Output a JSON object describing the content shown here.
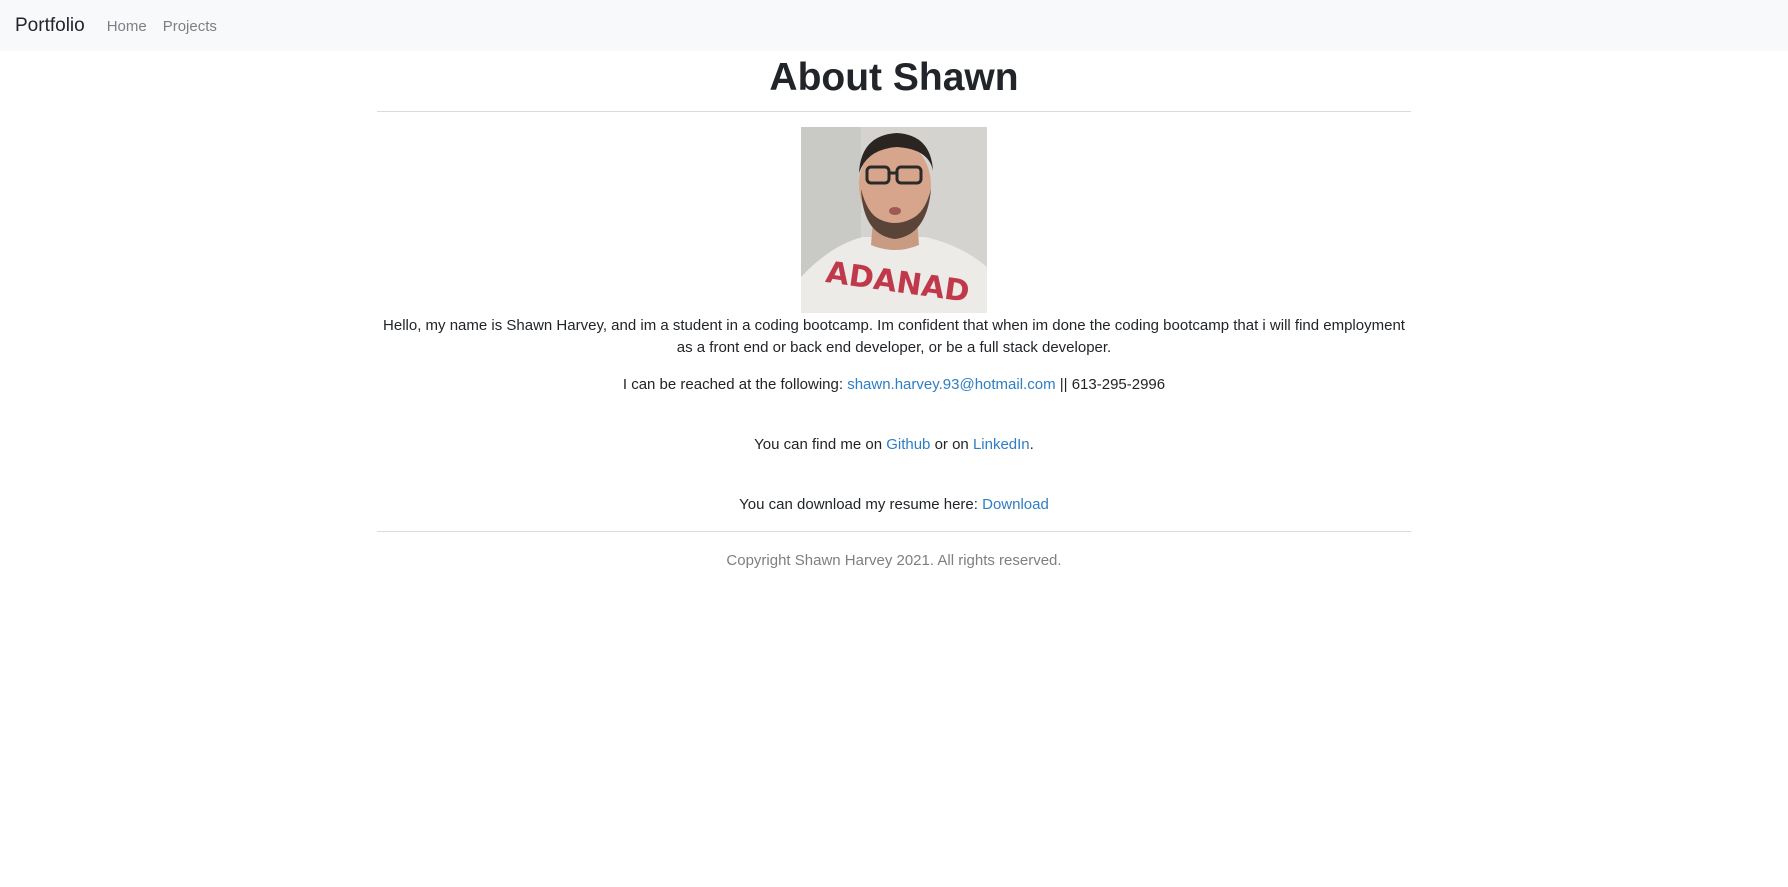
{
  "navbar": {
    "brand": "Portfolio",
    "links": [
      {
        "label": "Home"
      },
      {
        "label": "Projects"
      }
    ]
  },
  "main": {
    "title": "About Shawn",
    "photo_alt": "Photo of Shawn Harvey",
    "shirt_text": "ADANAD",
    "bio": "Hello, my name is Shawn Harvey, and im a student in a coding bootcamp. Im confident that when im done the coding bootcamp that i will find employment as a front end or back end developer, or be a full stack developer.",
    "contact": {
      "prefix": "I can be reached at the following: ",
      "email": "shawn.harvey.93@hotmail.com",
      "separator": " || ",
      "phone": "613-295-2996"
    },
    "find": {
      "prefix": "You can find me on ",
      "github": "Github",
      "middle": " or on ",
      "linkedin": "LinkedIn",
      "suffix": "."
    },
    "resume": {
      "prefix": "You can download my resume here: ",
      "link": "Download"
    }
  },
  "footer": {
    "copyright": "Copyright Shawn Harvey 2021. All rights reserved."
  },
  "colors": {
    "link": "#2f7dc4",
    "navbar_bg": "#f8f9fa",
    "muted_text": "#7c7f83"
  }
}
